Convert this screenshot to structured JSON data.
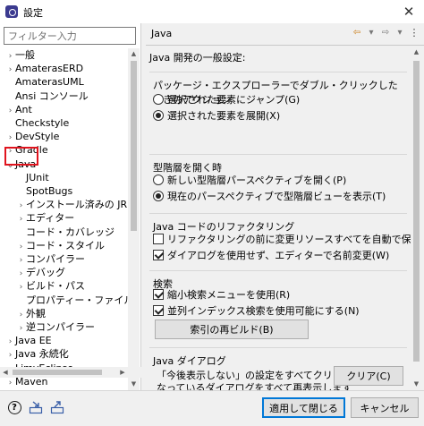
{
  "window": {
    "title": "設定",
    "close_glyph": "✕"
  },
  "filter": {
    "placeholder": "フィルター入力"
  },
  "tree": {
    "items": [
      {
        "label": "一般",
        "arrow": "›"
      },
      {
        "label": "AmaterasERD",
        "arrow": "›"
      },
      {
        "label": "AmaterasUML",
        "arrow": ""
      },
      {
        "label": "Ansi コンソール",
        "arrow": ""
      },
      {
        "label": "Ant",
        "arrow": "›"
      },
      {
        "label": "Checkstyle",
        "arrow": ""
      },
      {
        "label": "DevStyle",
        "arrow": "›"
      },
      {
        "label": "Gradle",
        "arrow": "›"
      },
      {
        "label": "Java",
        "arrow": "⌄"
      },
      {
        "label": "JUnit",
        "arrow": ""
      },
      {
        "label": "SpotBugs",
        "arrow": ""
      },
      {
        "label": "インストール済みの JRE",
        "arrow": "›"
      },
      {
        "label": "エディター",
        "arrow": "›"
      },
      {
        "label": "コード・カバレッジ",
        "arrow": ""
      },
      {
        "label": "コード・スタイル",
        "arrow": "›"
      },
      {
        "label": "コンパイラー",
        "arrow": "›"
      },
      {
        "label": "デバッグ",
        "arrow": "›"
      },
      {
        "label": "ビルド・パス",
        "arrow": "›"
      },
      {
        "label": "プロパティー・ファイル・エディタ",
        "arrow": ""
      },
      {
        "label": "外観",
        "arrow": "›"
      },
      {
        "label": "逆コンパイラー",
        "arrow": "›"
      },
      {
        "label": "Java EE",
        "arrow": "›"
      },
      {
        "label": "Java 永続化",
        "arrow": "›"
      },
      {
        "label": "LimyEclipse",
        "arrow": "›"
      },
      {
        "label": "Maven",
        "arrow": "›"
      }
    ]
  },
  "page": {
    "title": "Java",
    "description": "Java 開発の一般設定:",
    "nav": {
      "back_glyph": "⇦",
      "dropdown_glyph": "▾",
      "forward_glyph": "⇨",
      "menu_glyph": "⋮"
    },
    "package_explorer": {
      "label": "パッケージ・エクスプローラーでダブル・クリックしたときのアクション",
      "options": [
        {
          "label": "選択された要素にジャンプ(G)",
          "selected": false
        },
        {
          "label": "選択された要素を展開(X)",
          "selected": true
        }
      ]
    },
    "type_hierarchy": {
      "label": "型階層を開く時",
      "options": [
        {
          "label": "新しい型階層パースペクティブを開く(P)",
          "selected": false
        },
        {
          "label": "現在のパースペクティブで型階層ビューを表示(T)",
          "selected": true
        }
      ]
    },
    "refactoring": {
      "label": "Java コードのリファクタリング",
      "options": [
        {
          "label": "リファクタリングの前に変更リソースすべてを自動で保存(S)",
          "checked": false
        },
        {
          "label": "ダイアログを使用せず、エディターで名前変更(W)",
          "checked": true
        }
      ]
    },
    "search": {
      "label": "検索",
      "options": [
        {
          "label": "縮小検索メニューを使用(R)",
          "checked": true
        },
        {
          "label": "並列インデックス検索を使用可能にする(N)",
          "checked": true
        }
      ],
      "rebuild_button": "索引の再ビルド(B)"
    },
    "dialogs": {
      "label": "Java ダイアログ",
      "text_line1": "「今後表示しない」の設定をすべてクリアし、非表示に",
      "text_line2": "なっているダイアログをすべて再表示します",
      "clear_button": "クリア(C)"
    }
  },
  "footer": {
    "apply_close_button": "適用して閉じる",
    "cancel_button": "キャンセル",
    "help_glyph": "?"
  },
  "colors": {
    "highlight_border": "#e0141e",
    "default_button_border": "#0078d7"
  }
}
